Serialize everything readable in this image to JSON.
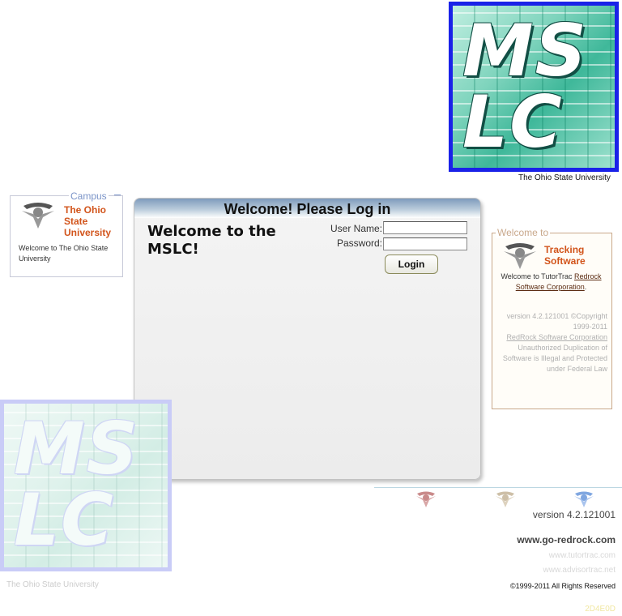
{
  "logo": {
    "line1": "MS",
    "line2": "LC",
    "caption": "The Ohio State University"
  },
  "campus": {
    "legend": "Campus",
    "title": "The Ohio State University",
    "description": "Welcome to The Ohio State University"
  },
  "login": {
    "header": "Welcome! Please Log in",
    "welcome_message": "Welcome to the MSLC!",
    "username_label": "User Name:",
    "password_label": "Password:",
    "username_value": "",
    "password_value": "",
    "login_button": "Login"
  },
  "welcome_box": {
    "legend": "Welcome to",
    "title": "Tracking Software",
    "text_prefix": "Welcome to TutorTrac",
    "company_link": "Redrock Software Corporation",
    "text_suffix": ".",
    "version_text": "version 4.2.121001 ©Copyright 1999-2011",
    "redrock_link": "RedRock Software Corporation",
    "notice": "Unauthorized Duplication of Software is Illegal and Protected under Federal Law"
  },
  "footer": {
    "version": "version 4.2.121001",
    "site_main": "www.go-redrock.com",
    "site_tutortrac": "www.tutortrac.com",
    "site_advisortrac": "www.advisortrac.net",
    "copyright": "©1999-2011 All Rights Reserved",
    "code": "2D4E0D"
  },
  "colors": {
    "accent_orange": "#d2541b",
    "logo_border": "#1a22e8",
    "header_blue": "#7e9bbc",
    "icon_red": "#c98a8a",
    "icon_tan": "#cdbfa7",
    "icon_blue": "#7fa6e0"
  }
}
